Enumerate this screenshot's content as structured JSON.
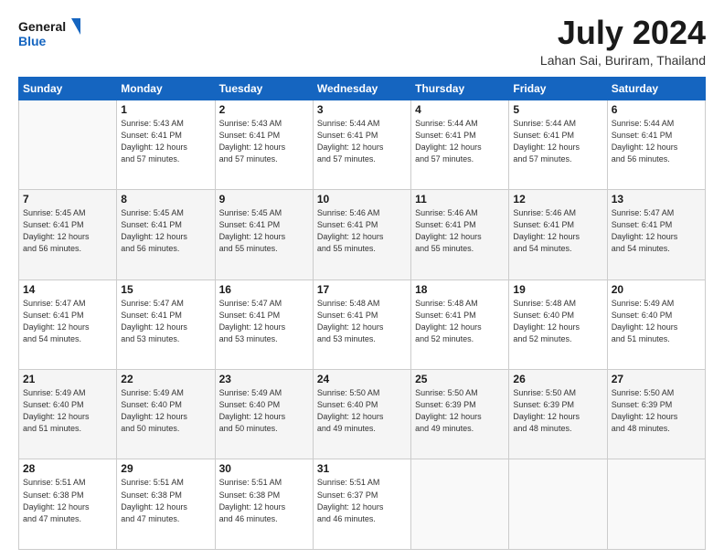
{
  "logo": {
    "line1": "General",
    "line2": "Blue"
  },
  "header": {
    "month_year": "July 2024",
    "location": "Lahan Sai, Buriram, Thailand"
  },
  "days_of_week": [
    "Sunday",
    "Monday",
    "Tuesday",
    "Wednesday",
    "Thursday",
    "Friday",
    "Saturday"
  ],
  "weeks": [
    [
      {
        "num": "",
        "empty": true
      },
      {
        "num": "1",
        "sunrise": "5:43 AM",
        "sunset": "6:41 PM",
        "daylight": "12 hours and 57 minutes."
      },
      {
        "num": "2",
        "sunrise": "5:43 AM",
        "sunset": "6:41 PM",
        "daylight": "12 hours and 57 minutes."
      },
      {
        "num": "3",
        "sunrise": "5:44 AM",
        "sunset": "6:41 PM",
        "daylight": "12 hours and 57 minutes."
      },
      {
        "num": "4",
        "sunrise": "5:44 AM",
        "sunset": "6:41 PM",
        "daylight": "12 hours and 57 minutes."
      },
      {
        "num": "5",
        "sunrise": "5:44 AM",
        "sunset": "6:41 PM",
        "daylight": "12 hours and 57 minutes."
      },
      {
        "num": "6",
        "sunrise": "5:44 AM",
        "sunset": "6:41 PM",
        "daylight": "12 hours and 56 minutes."
      }
    ],
    [
      {
        "num": "7",
        "sunrise": "5:45 AM",
        "sunset": "6:41 PM",
        "daylight": "12 hours and 56 minutes."
      },
      {
        "num": "8",
        "sunrise": "5:45 AM",
        "sunset": "6:41 PM",
        "daylight": "12 hours and 56 minutes."
      },
      {
        "num": "9",
        "sunrise": "5:45 AM",
        "sunset": "6:41 PM",
        "daylight": "12 hours and 55 minutes."
      },
      {
        "num": "10",
        "sunrise": "5:46 AM",
        "sunset": "6:41 PM",
        "daylight": "12 hours and 55 minutes."
      },
      {
        "num": "11",
        "sunrise": "5:46 AM",
        "sunset": "6:41 PM",
        "daylight": "12 hours and 55 minutes."
      },
      {
        "num": "12",
        "sunrise": "5:46 AM",
        "sunset": "6:41 PM",
        "daylight": "12 hours and 54 minutes."
      },
      {
        "num": "13",
        "sunrise": "5:47 AM",
        "sunset": "6:41 PM",
        "daylight": "12 hours and 54 minutes."
      }
    ],
    [
      {
        "num": "14",
        "sunrise": "5:47 AM",
        "sunset": "6:41 PM",
        "daylight": "12 hours and 54 minutes."
      },
      {
        "num": "15",
        "sunrise": "5:47 AM",
        "sunset": "6:41 PM",
        "daylight": "12 hours and 53 minutes."
      },
      {
        "num": "16",
        "sunrise": "5:47 AM",
        "sunset": "6:41 PM",
        "daylight": "12 hours and 53 minutes."
      },
      {
        "num": "17",
        "sunrise": "5:48 AM",
        "sunset": "6:41 PM",
        "daylight": "12 hours and 53 minutes."
      },
      {
        "num": "18",
        "sunrise": "5:48 AM",
        "sunset": "6:41 PM",
        "daylight": "12 hours and 52 minutes."
      },
      {
        "num": "19",
        "sunrise": "5:48 AM",
        "sunset": "6:40 PM",
        "daylight": "12 hours and 52 minutes."
      },
      {
        "num": "20",
        "sunrise": "5:49 AM",
        "sunset": "6:40 PM",
        "daylight": "12 hours and 51 minutes."
      }
    ],
    [
      {
        "num": "21",
        "sunrise": "5:49 AM",
        "sunset": "6:40 PM",
        "daylight": "12 hours and 51 minutes."
      },
      {
        "num": "22",
        "sunrise": "5:49 AM",
        "sunset": "6:40 PM",
        "daylight": "12 hours and 50 minutes."
      },
      {
        "num": "23",
        "sunrise": "5:49 AM",
        "sunset": "6:40 PM",
        "daylight": "12 hours and 50 minutes."
      },
      {
        "num": "24",
        "sunrise": "5:50 AM",
        "sunset": "6:40 PM",
        "daylight": "12 hours and 49 minutes."
      },
      {
        "num": "25",
        "sunrise": "5:50 AM",
        "sunset": "6:39 PM",
        "daylight": "12 hours and 49 minutes."
      },
      {
        "num": "26",
        "sunrise": "5:50 AM",
        "sunset": "6:39 PM",
        "daylight": "12 hours and 48 minutes."
      },
      {
        "num": "27",
        "sunrise": "5:50 AM",
        "sunset": "6:39 PM",
        "daylight": "12 hours and 48 minutes."
      }
    ],
    [
      {
        "num": "28",
        "sunrise": "5:51 AM",
        "sunset": "6:38 PM",
        "daylight": "12 hours and 47 minutes."
      },
      {
        "num": "29",
        "sunrise": "5:51 AM",
        "sunset": "6:38 PM",
        "daylight": "12 hours and 47 minutes."
      },
      {
        "num": "30",
        "sunrise": "5:51 AM",
        "sunset": "6:38 PM",
        "daylight": "12 hours and 46 minutes."
      },
      {
        "num": "31",
        "sunrise": "5:51 AM",
        "sunset": "6:37 PM",
        "daylight": "12 hours and 46 minutes."
      },
      {
        "num": "",
        "empty": true
      },
      {
        "num": "",
        "empty": true
      },
      {
        "num": "",
        "empty": true
      }
    ]
  ],
  "labels": {
    "sunrise_prefix": "Sunrise: ",
    "sunset_prefix": "Sunset: ",
    "daylight_prefix": "Daylight: "
  }
}
